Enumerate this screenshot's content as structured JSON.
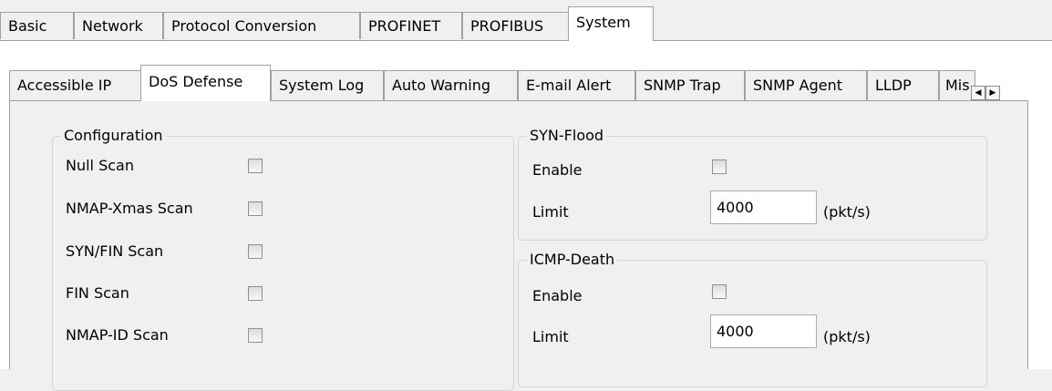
{
  "top_tabs": [
    "Basic",
    "Network",
    "Protocol Conversion",
    "PROFINET",
    "PROFIBUS",
    "System"
  ],
  "top_active": "System",
  "sub_tabs": [
    "Accessible IP",
    "DoS Defense",
    "System Log",
    "Auto Warning",
    "E-mail Alert",
    "SNMP Trap",
    "SNMP Agent",
    "LLDP",
    "Mis"
  ],
  "sub_active": "DoS Defense",
  "configuration": {
    "title": "Configuration",
    "items": [
      {
        "label": "Null Scan",
        "checked": false
      },
      {
        "label": "NMAP-Xmas Scan",
        "checked": false
      },
      {
        "label": "SYN/FIN Scan",
        "checked": false
      },
      {
        "label": "FIN Scan",
        "checked": false
      },
      {
        "label": "NMAP-ID Scan",
        "checked": false
      }
    ]
  },
  "syn_flood": {
    "title": "SYN-Flood",
    "enable_label": "Enable",
    "enabled": false,
    "limit_label": "Limit",
    "limit_value": "4000",
    "unit": "(pkt/s)"
  },
  "icmp_death": {
    "title": "ICMP-Death",
    "enable_label": "Enable",
    "enabled": false,
    "limit_label": "Limit",
    "limit_value": "4000",
    "unit": "(pkt/s)"
  },
  "scroll": {
    "left_glyph": "◀",
    "right_glyph": "▶"
  }
}
